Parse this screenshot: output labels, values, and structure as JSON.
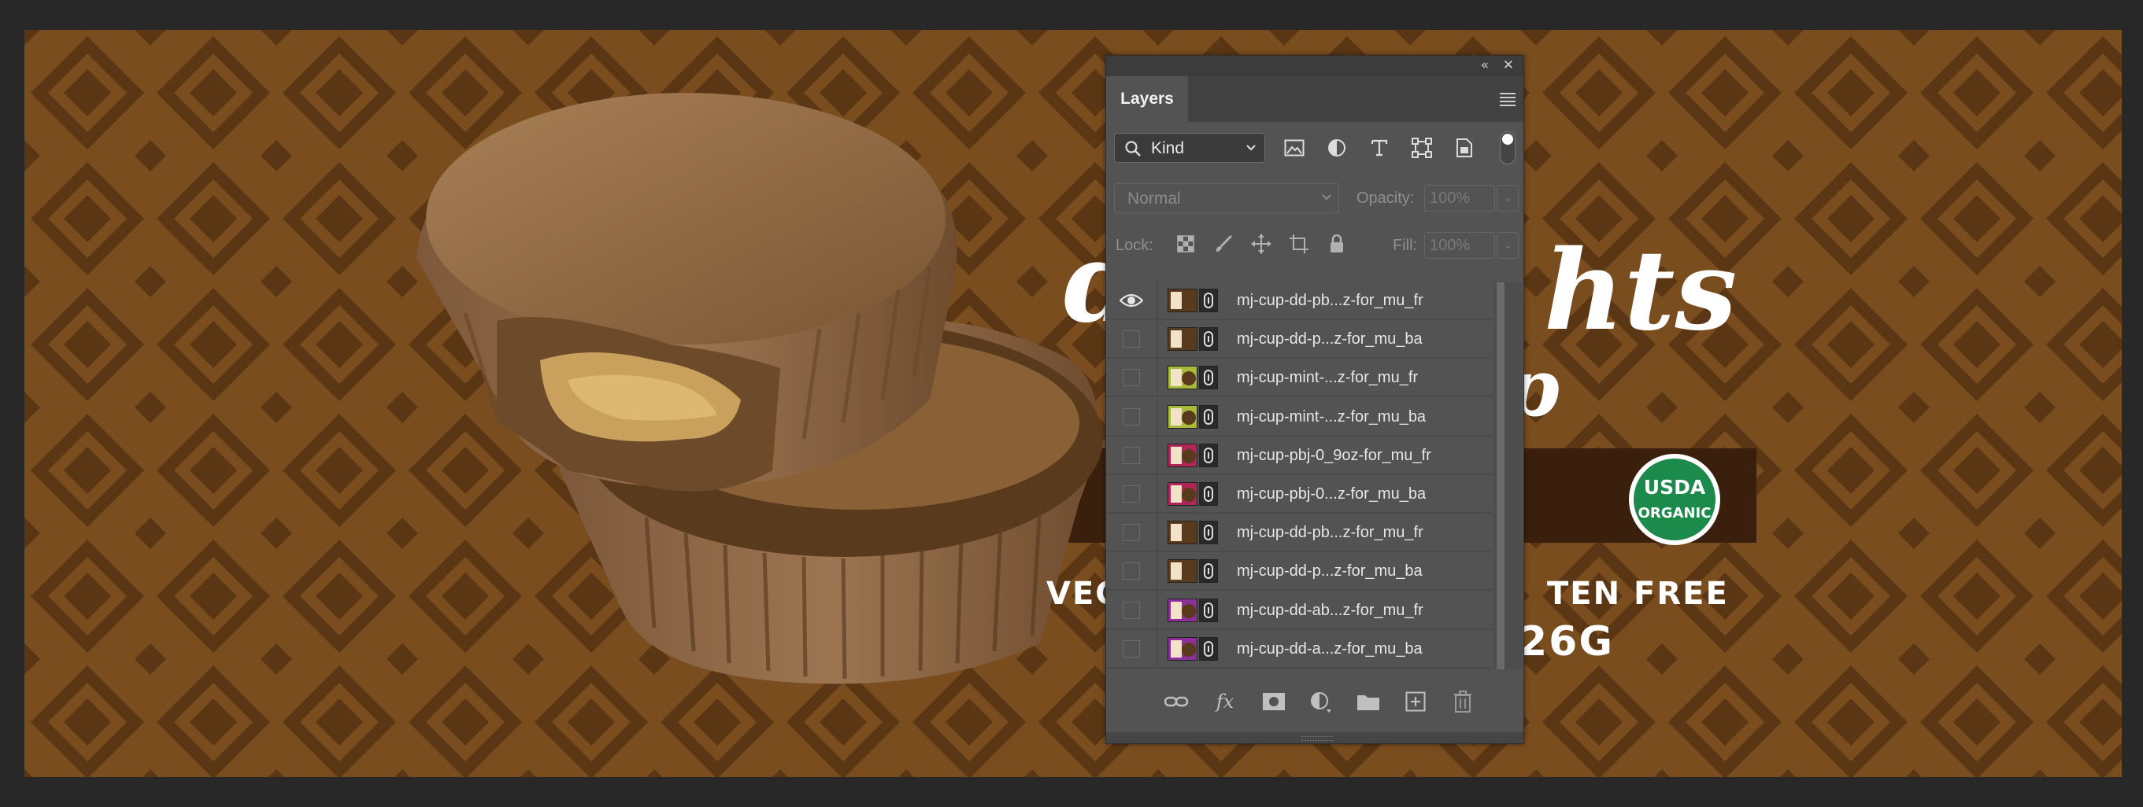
{
  "window": {
    "background": "#282828"
  },
  "canvas": {
    "background_color": "#7a4d1f",
    "pattern_color": "#5a3614",
    "visible_text": {
      "brand_partial_left": "d",
      "brand_partial_right": "hts",
      "flavor_partial": "p",
      "claims_left": "VEG",
      "claims_right": "TEN FREE",
      "weight_partial": "26G"
    },
    "usda_badge": {
      "top": "USDA",
      "bottom": "ORGANIC",
      "color": "#1b8a4a"
    }
  },
  "panel": {
    "collapse_glyph": "«",
    "close_glyph": "✕",
    "tab_label": "Layers",
    "filter": {
      "label": "Kind",
      "icons": [
        "image-filter-icon",
        "adjustment-filter-icon",
        "type-filter-icon",
        "shape-filter-icon",
        "smart-object-filter-icon"
      ]
    },
    "blend_mode": "Normal",
    "opacity_label": "Opacity:",
    "opacity_value": "100%",
    "lock_label": "Lock:",
    "fill_label": "Fill:",
    "fill_value": "100%",
    "layers": [
      {
        "name": "mj-cup-dd-pb...z-for_mu_fr",
        "visible": true,
        "thumb": "#5a3a1c"
      },
      {
        "name": "mj-cup-dd-p...z-for_mu_ba",
        "visible": false,
        "thumb": "#5a3a1c"
      },
      {
        "name": "mj-cup-mint-...z-for_mu_fr",
        "visible": false,
        "thumb": "#a9bb3a"
      },
      {
        "name": "mj-cup-mint-...z-for_mu_ba",
        "visible": false,
        "thumb": "#a9bb3a"
      },
      {
        "name": "mj-cup-pbj-0_9oz-for_mu_fr",
        "visible": false,
        "thumb": "#b0265a"
      },
      {
        "name": "mj-cup-pbj-0...z-for_mu_ba",
        "visible": false,
        "thumb": "#b0265a"
      },
      {
        "name": "mj-cup-dd-pb...z-for_mu_fr",
        "visible": false,
        "thumb": "#5a3a1c"
      },
      {
        "name": "mj-cup-dd-p...z-for_mu_ba",
        "visible": false,
        "thumb": "#5a3a1c"
      },
      {
        "name": "mj-cup-dd-ab...z-for_mu_fr",
        "visible": false,
        "thumb": "#8d2f9a"
      },
      {
        "name": "mj-cup-dd-a...z-for_mu_ba",
        "visible": false,
        "thumb": "#8d2f9a"
      }
    ]
  }
}
